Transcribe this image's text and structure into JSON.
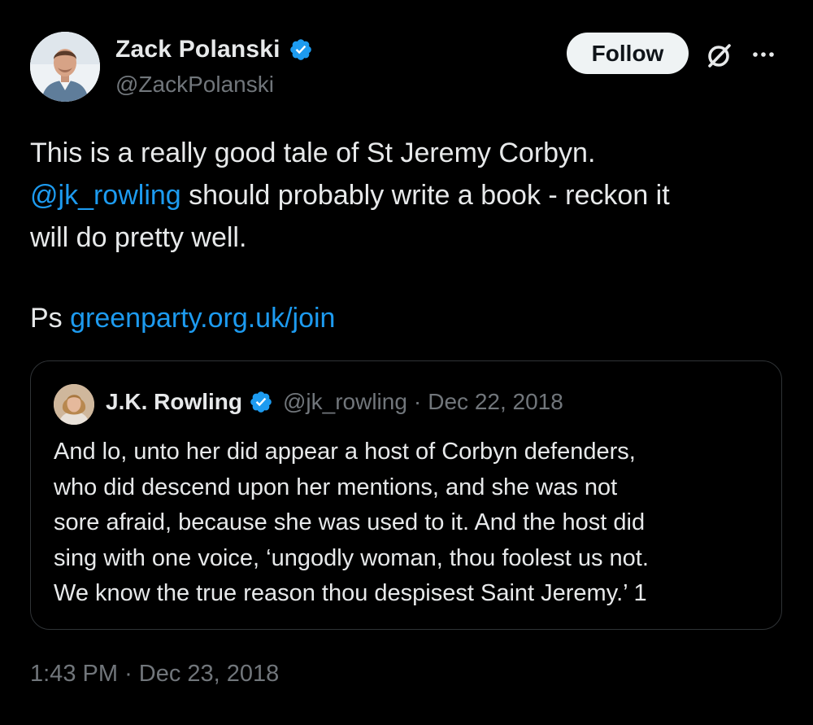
{
  "author": {
    "name": "Zack Polanski",
    "handle": "@ZackPolanski"
  },
  "follow_label": "Follow",
  "tweet": {
    "line1": "This is a really good tale of St Jeremy Corbyn.",
    "mention": "@jk_rowling",
    "line2_rest": " should probably write a book - reckon it",
    "line3": "will do pretty well.",
    "ps_prefix": "Ps ",
    "ps_link": "greenparty.org.uk/join"
  },
  "quote": {
    "name": "J.K. Rowling",
    "handle": "@jk_rowling",
    "separator": "·",
    "date": "Dec 22, 2018",
    "lines": [
      "And lo, unto her did appear a host of Corbyn defenders,",
      "who did descend upon her mentions, and she was not",
      "sore afraid, because she was used to it. And the host did",
      "sing with one voice, ‘ungodly woman, thou foolest us not.",
      "We know the true reason thou despisest Saint Jeremy.’ 1"
    ]
  },
  "timestamp": {
    "time": "1:43 PM",
    "separator": "·",
    "date": "Dec 23, 2018"
  },
  "colors": {
    "background": "#000000",
    "text": "#e7e9ea",
    "muted": "#71767b",
    "link": "#1d9bf0",
    "verified": "#1d9bf0",
    "border": "#2f3336"
  },
  "icons": {
    "verified": "verified-badge-icon",
    "grok": "grok-icon",
    "more": "more-horizontal-icon"
  }
}
